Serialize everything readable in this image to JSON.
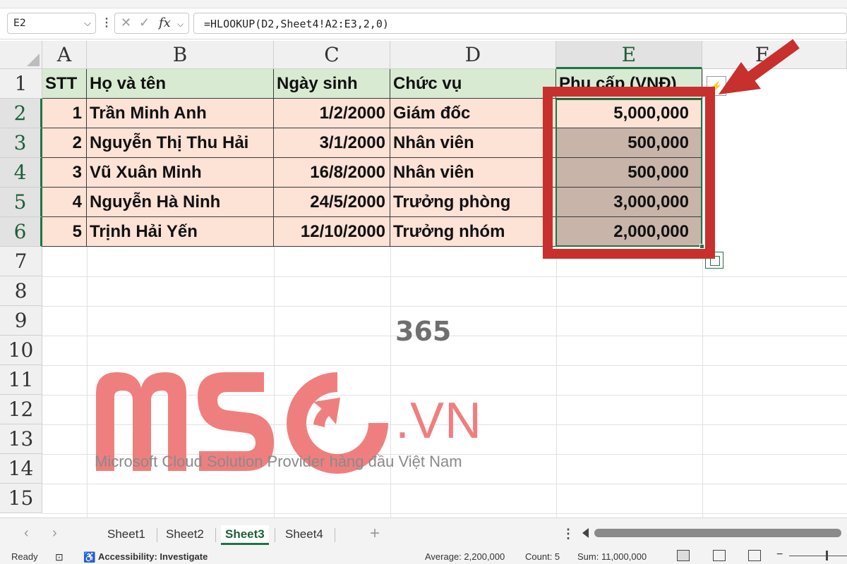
{
  "formula_bar": {
    "name_box": "E2",
    "formula": "=HLOOKUP(D2,Sheet4!A2:E3,2,0)",
    "fx_label": "fx"
  },
  "columns": [
    "A",
    "B",
    "C",
    "D",
    "E",
    "F"
  ],
  "rows": [
    "1",
    "2",
    "3",
    "4",
    "5",
    "6",
    "7",
    "8",
    "9",
    "10",
    "11",
    "12",
    "13",
    "14",
    "15"
  ],
  "table": {
    "headers": [
      "STT",
      "Họ và tên",
      "Ngày sinh",
      "Chức vụ",
      "Phụ cấp (VNĐ)"
    ],
    "rows": [
      [
        "1",
        "Trần Minh Anh",
        "1/2/2000",
        "Giám đốc",
        "5,000,000"
      ],
      [
        "2",
        "Nguyễn Thị Thu Hải",
        "3/1/2000",
        "Nhân viên",
        "500,000"
      ],
      [
        "3",
        "Vũ Xuân Minh",
        "16/8/2000",
        "Nhân viên",
        "500,000"
      ],
      [
        "4",
        "Nguyễn Hà Ninh",
        "24/5/2000",
        "Trưởng phòng",
        "3,000,000"
      ],
      [
        "5",
        "Trịnh Hải Yến",
        "12/10/2000",
        "Trưởng nhóm",
        "2,000,000"
      ]
    ]
  },
  "watermark": {
    "brand": "MSO",
    "suffix": "365",
    "domain": ".VN",
    "tagline": "Microsoft Cloud Solution Provider hàng đầu Việt Nam"
  },
  "sheet_tabs": {
    "tabs": [
      "Sheet1",
      "Sheet2",
      "Sheet3",
      "Sheet4"
    ],
    "active": "Sheet3",
    "add": "+"
  },
  "status_bar": {
    "ready": "Ready",
    "accessibility": "Accessibility: Investigate",
    "average": "Average: 2,200,000",
    "count": "Count: 5",
    "sum": "Sum: 11,000,000"
  },
  "colors": {
    "accent_green": "#217346",
    "annotation_red": "#c8302d",
    "header_fill": "#d9ead3",
    "body_fill": "#fde2d6",
    "result_fill": "#c9b4aa",
    "watermark_pink": "#ef7f7f"
  }
}
